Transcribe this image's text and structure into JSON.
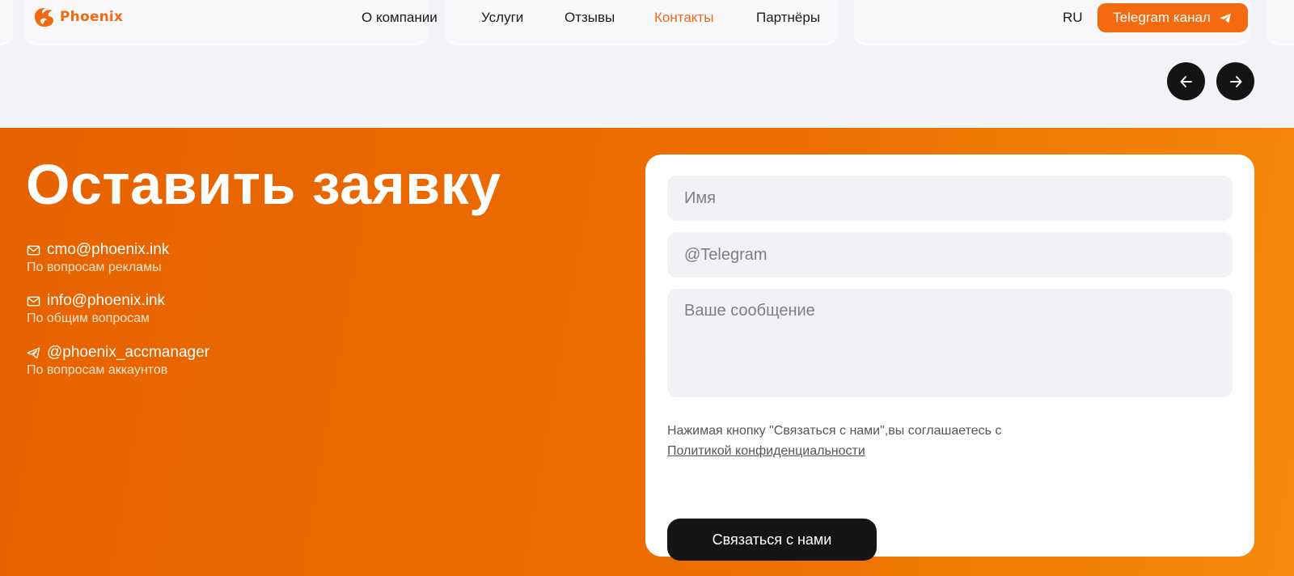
{
  "header": {
    "logo_text": "Phoenix",
    "nav": [
      {
        "label": "О компании",
        "active": false
      },
      {
        "label": "Услуги",
        "active": false
      },
      {
        "label": "Отзывы",
        "active": false
      },
      {
        "label": "Контакты",
        "active": true
      },
      {
        "label": "Партнёры",
        "active": false
      }
    ],
    "language": "RU",
    "telegram_button": "Telegram канал"
  },
  "slider": {
    "prev_icon": "arrow-left-icon",
    "next_icon": "arrow-right-icon"
  },
  "contact_section": {
    "title": "Оставить заявку",
    "contacts": [
      {
        "icon": "mail-icon",
        "value": "cmo@phoenix.ink",
        "description": "По вопросам рекламы"
      },
      {
        "icon": "mail-icon",
        "value": "info@phoenix.ink",
        "description": "По общим вопросам"
      },
      {
        "icon": "telegram-icon",
        "value": "@phoenix_accmanager",
        "description": "По вопросам аккаунтов"
      }
    ]
  },
  "form": {
    "name_placeholder": "Имя",
    "telegram_placeholder": "@Telegram",
    "message_placeholder": "Ваше сообщение",
    "consent_text": "Нажимая кнопку \"Связаться с нами\",вы соглашаетесь с",
    "privacy_link": "Политикой конфиденциальности",
    "submit_label": "Связаться с нами"
  },
  "colors": {
    "accent": "#f46a10",
    "dark_button": "#151515",
    "field_bg": "#f2f2f6"
  }
}
